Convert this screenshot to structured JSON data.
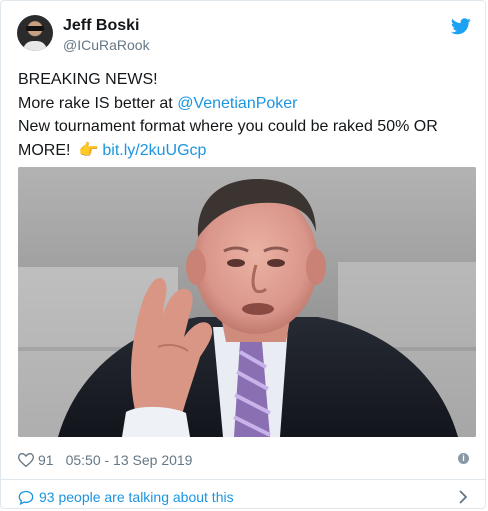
{
  "author": {
    "name": "Jeff Boski",
    "handle": "@ICuRaRook",
    "avatar_icon": "avatar-photo"
  },
  "brand_icon": "twitter-bird-icon",
  "tweet": {
    "line1": "BREAKING NEWS!",
    "line2_prefix": "More rake IS better at ",
    "mention": "@VenetianPoker",
    "line3": "New tournament format where you could be raked 50% OR",
    "line4_prefix": "MORE!",
    "emoji": "👉",
    "link": "bit.ly/2kuUGcp"
  },
  "media": {
    "type": "photo",
    "subject": "elderly man in a dark suit and striped tie, hand raised"
  },
  "meta": {
    "likes": "91",
    "timestamp": "05:50 - 13 Sep 2019"
  },
  "conversation": {
    "label": "93 people are talking about this"
  },
  "colors": {
    "link": "#1b95e0",
    "muted": "#657786",
    "text": "#14171a",
    "border": "#e1e8ed"
  }
}
